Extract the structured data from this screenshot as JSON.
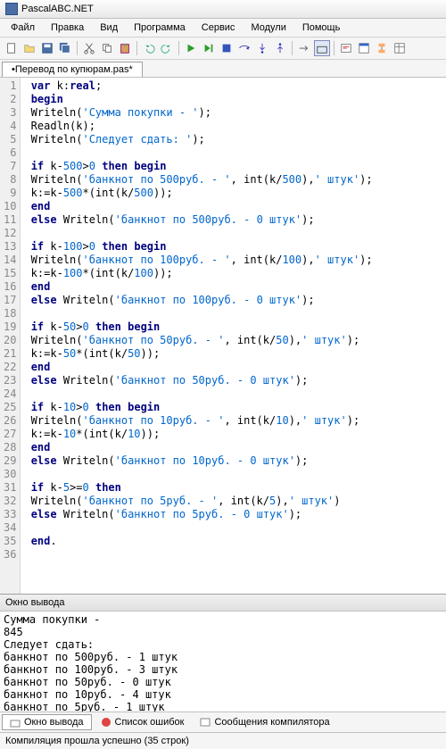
{
  "window": {
    "title": "PascalABC.NET"
  },
  "menu": {
    "items": [
      "Файл",
      "Правка",
      "Вид",
      "Программа",
      "Сервис",
      "Модули",
      "Помощь"
    ]
  },
  "tabs": {
    "active": "•Перевод по купюрам.pas*"
  },
  "code_lines": [
    {
      "n": "1",
      "tokens": [
        [
          " ",
          "p"
        ],
        [
          "var",
          "k"
        ],
        [
          " k:",
          "p"
        ],
        [
          "real",
          "k"
        ],
        [
          ";",
          "p"
        ]
      ]
    },
    {
      "n": "2",
      "tokens": [
        [
          " ",
          "p"
        ],
        [
          "begin",
          "k"
        ]
      ]
    },
    {
      "n": "3",
      "tokens": [
        [
          " Writeln(",
          "p"
        ],
        [
          "'Сумма покупки - '",
          "s"
        ],
        [
          ");",
          "p"
        ]
      ]
    },
    {
      "n": "4",
      "tokens": [
        [
          " Readln(k);",
          "p"
        ]
      ]
    },
    {
      "n": "5",
      "tokens": [
        [
          " Writeln(",
          "p"
        ],
        [
          "'Следует сдать: '",
          "s"
        ],
        [
          ");",
          "p"
        ]
      ]
    },
    {
      "n": "6",
      "tokens": [
        [
          "",
          "p"
        ]
      ]
    },
    {
      "n": "7",
      "tokens": [
        [
          " ",
          "p"
        ],
        [
          "if",
          "k"
        ],
        [
          " k-",
          "p"
        ],
        [
          "500",
          "n"
        ],
        [
          ">",
          "p"
        ],
        [
          "0",
          "n"
        ],
        [
          " ",
          "p"
        ],
        [
          "then",
          "k"
        ],
        [
          " ",
          "p"
        ],
        [
          "begin",
          "k"
        ]
      ]
    },
    {
      "n": "8",
      "tokens": [
        [
          " Writeln(",
          "p"
        ],
        [
          "'банкнот по 500руб. - '",
          "s"
        ],
        [
          ", int(k/",
          "p"
        ],
        [
          "500",
          "n"
        ],
        [
          "),",
          "p"
        ],
        [
          "' штук'",
          "s"
        ],
        [
          ");",
          "p"
        ]
      ]
    },
    {
      "n": "9",
      "tokens": [
        [
          " k:=k-",
          "p"
        ],
        [
          "500",
          "n"
        ],
        [
          "*(int(k/",
          "p"
        ],
        [
          "500",
          "n"
        ],
        [
          "));",
          "p"
        ]
      ]
    },
    {
      "n": "10",
      "tokens": [
        [
          " ",
          "p"
        ],
        [
          "end",
          "k"
        ]
      ]
    },
    {
      "n": "11",
      "tokens": [
        [
          " ",
          "p"
        ],
        [
          "else",
          "k"
        ],
        [
          " Writeln(",
          "p"
        ],
        [
          "'банкнот по 500руб. - 0 штук'",
          "s"
        ],
        [
          ");",
          "p"
        ]
      ]
    },
    {
      "n": "12",
      "tokens": [
        [
          "",
          "p"
        ]
      ]
    },
    {
      "n": "13",
      "tokens": [
        [
          " ",
          "p"
        ],
        [
          "if",
          "k"
        ],
        [
          " k-",
          "p"
        ],
        [
          "100",
          "n"
        ],
        [
          ">",
          "p"
        ],
        [
          "0",
          "n"
        ],
        [
          " ",
          "p"
        ],
        [
          "then",
          "k"
        ],
        [
          " ",
          "p"
        ],
        [
          "begin",
          "k"
        ]
      ]
    },
    {
      "n": "14",
      "tokens": [
        [
          " Writeln(",
          "p"
        ],
        [
          "'банкнот по 100руб. - '",
          "s"
        ],
        [
          ", int(k/",
          "p"
        ],
        [
          "100",
          "n"
        ],
        [
          "),",
          "p"
        ],
        [
          "' штук'",
          "s"
        ],
        [
          ");",
          "p"
        ]
      ]
    },
    {
      "n": "15",
      "tokens": [
        [
          " k:=k-",
          "p"
        ],
        [
          "100",
          "n"
        ],
        [
          "*(int(k/",
          "p"
        ],
        [
          "100",
          "n"
        ],
        [
          "));",
          "p"
        ]
      ]
    },
    {
      "n": "16",
      "tokens": [
        [
          " ",
          "p"
        ],
        [
          "end",
          "k"
        ]
      ]
    },
    {
      "n": "17",
      "tokens": [
        [
          " ",
          "p"
        ],
        [
          "else",
          "k"
        ],
        [
          " Writeln(",
          "p"
        ],
        [
          "'банкнот по 100руб. - 0 штук'",
          "s"
        ],
        [
          ");",
          "p"
        ]
      ]
    },
    {
      "n": "18",
      "tokens": [
        [
          "",
          "p"
        ]
      ]
    },
    {
      "n": "19",
      "tokens": [
        [
          " ",
          "p"
        ],
        [
          "if",
          "k"
        ],
        [
          " k-",
          "p"
        ],
        [
          "50",
          "n"
        ],
        [
          ">",
          "p"
        ],
        [
          "0",
          "n"
        ],
        [
          " ",
          "p"
        ],
        [
          "then",
          "k"
        ],
        [
          " ",
          "p"
        ],
        [
          "begin",
          "k"
        ]
      ]
    },
    {
      "n": "20",
      "tokens": [
        [
          " Writeln(",
          "p"
        ],
        [
          "'банкнот по 50руб. - '",
          "s"
        ],
        [
          ", int(k/",
          "p"
        ],
        [
          "50",
          "n"
        ],
        [
          "),",
          "p"
        ],
        [
          "' штук'",
          "s"
        ],
        [
          ");",
          "p"
        ]
      ]
    },
    {
      "n": "21",
      "tokens": [
        [
          " k:=k-",
          "p"
        ],
        [
          "50",
          "n"
        ],
        [
          "*(int(k/",
          "p"
        ],
        [
          "50",
          "n"
        ],
        [
          "));",
          "p"
        ]
      ]
    },
    {
      "n": "22",
      "tokens": [
        [
          " ",
          "p"
        ],
        [
          "end",
          "k"
        ]
      ]
    },
    {
      "n": "23",
      "tokens": [
        [
          " ",
          "p"
        ],
        [
          "else",
          "k"
        ],
        [
          " Writeln(",
          "p"
        ],
        [
          "'банкнот по 50руб. - 0 штук'",
          "s"
        ],
        [
          ");",
          "p"
        ]
      ]
    },
    {
      "n": "24",
      "tokens": [
        [
          "",
          "p"
        ]
      ]
    },
    {
      "n": "25",
      "tokens": [
        [
          " ",
          "p"
        ],
        [
          "if",
          "k"
        ],
        [
          " k-",
          "p"
        ],
        [
          "10",
          "n"
        ],
        [
          ">",
          "p"
        ],
        [
          "0",
          "n"
        ],
        [
          " ",
          "p"
        ],
        [
          "then",
          "k"
        ],
        [
          " ",
          "p"
        ],
        [
          "begin",
          "k"
        ]
      ]
    },
    {
      "n": "26",
      "tokens": [
        [
          " Writeln(",
          "p"
        ],
        [
          "'банкнот по 10руб. - '",
          "s"
        ],
        [
          ", int(k/",
          "p"
        ],
        [
          "10",
          "n"
        ],
        [
          "),",
          "p"
        ],
        [
          "' штук'",
          "s"
        ],
        [
          ");",
          "p"
        ]
      ]
    },
    {
      "n": "27",
      "tokens": [
        [
          " k:=k-",
          "p"
        ],
        [
          "10",
          "n"
        ],
        [
          "*(int(k/",
          "p"
        ],
        [
          "10",
          "n"
        ],
        [
          "));",
          "p"
        ]
      ]
    },
    {
      "n": "28",
      "tokens": [
        [
          " ",
          "p"
        ],
        [
          "end",
          "k"
        ]
      ]
    },
    {
      "n": "29",
      "tokens": [
        [
          " ",
          "p"
        ],
        [
          "else",
          "k"
        ],
        [
          " Writeln(",
          "p"
        ],
        [
          "'банкнот по 10руб. - 0 штук'",
          "s"
        ],
        [
          ");",
          "p"
        ]
      ]
    },
    {
      "n": "30",
      "tokens": [
        [
          "",
          "p"
        ]
      ]
    },
    {
      "n": "31",
      "tokens": [
        [
          " ",
          "p"
        ],
        [
          "if",
          "k"
        ],
        [
          " k-",
          "p"
        ],
        [
          "5",
          "n"
        ],
        [
          ">=",
          "p"
        ],
        [
          "0",
          "n"
        ],
        [
          " ",
          "p"
        ],
        [
          "then",
          "k"
        ]
      ]
    },
    {
      "n": "32",
      "tokens": [
        [
          " Writeln(",
          "p"
        ],
        [
          "'банкнот по 5руб. - '",
          "s"
        ],
        [
          ", int(k/",
          "p"
        ],
        [
          "5",
          "n"
        ],
        [
          "),",
          "p"
        ],
        [
          "' штук'",
          "s"
        ],
        [
          ")",
          "p"
        ]
      ]
    },
    {
      "n": "33",
      "tokens": [
        [
          " ",
          "p"
        ],
        [
          "else",
          "k"
        ],
        [
          " Writeln(",
          "p"
        ],
        [
          "'банкнот по 5руб. - 0 штук'",
          "s"
        ],
        [
          ");",
          "p"
        ]
      ]
    },
    {
      "n": "34",
      "tokens": [
        [
          "",
          "p"
        ]
      ]
    },
    {
      "n": "35",
      "tokens": [
        [
          " ",
          "p"
        ],
        [
          "end",
          "k"
        ],
        [
          ".",
          "p"
        ]
      ]
    },
    {
      "n": "36",
      "tokens": [
        [
          "",
          "p"
        ]
      ]
    }
  ],
  "output_panel": {
    "title": "Окно вывода",
    "lines": [
      "Сумма покупки -",
      "845",
      "Следует сдать:",
      "банкнот по 500руб. - 1 штук",
      "банкнот по 100руб. - 3 штук",
      "банкнот по 50руб. - 0 штук",
      "банкнот по 10руб. - 4 штук",
      "банкнот по 5руб. - 1 штук"
    ]
  },
  "bottom_tabs": {
    "items": [
      "Окно вывода",
      "Список ошибок",
      "Сообщения компилятора"
    ]
  },
  "status": {
    "text": "Компиляция прошла успешно (35 строк)"
  }
}
